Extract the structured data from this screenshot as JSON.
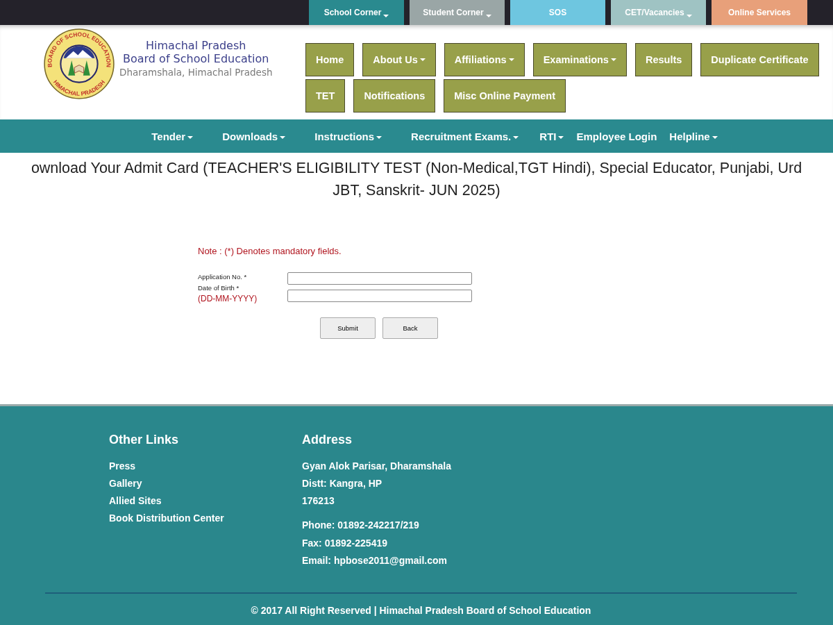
{
  "top_tabs": [
    {
      "label": "School Corner",
      "dropdown": true,
      "color": "#2a8a8f"
    },
    {
      "label": "Student Corner",
      "dropdown": true,
      "color": "#9aa6a6"
    },
    {
      "label": "SOS",
      "dropdown": false,
      "color": "#6ec6e0"
    },
    {
      "label": "CET/Vacancies",
      "dropdown": true,
      "color": "#9fc3c3"
    },
    {
      "label": "Online Services",
      "dropdown": false,
      "color": "#e8a07a"
    }
  ],
  "logo": {
    "ring_top": "BOARD OF SCHOOL EDUCATION",
    "ring_bottom": "HIMACHAL PRADESH"
  },
  "brand": {
    "line_1": "Himachal Pradesh",
    "line_2": "Board of School Education",
    "line_3": "Dharamshala, Himachal Pradesh"
  },
  "main_menu": [
    [
      {
        "label": "Home",
        "dropdown": false
      },
      {
        "label": "About Us",
        "dropdown": true
      },
      {
        "label": "Affiliations",
        "dropdown": true
      },
      {
        "label": "Examinations",
        "dropdown": true
      },
      {
        "label": "Results",
        "dropdown": false
      },
      {
        "label": "Duplicate Certificate",
        "dropdown": false
      }
    ],
    [
      {
        "label": "TET",
        "dropdown": false
      },
      {
        "label": "Notifications",
        "dropdown": false
      },
      {
        "label": "Misc Online Payment",
        "dropdown": false
      }
    ]
  ],
  "sub_menu": [
    {
      "label": "Tender",
      "dropdown": true
    },
    {
      "label": "Downloads",
      "dropdown": true
    },
    {
      "label": "Instructions",
      "dropdown": true
    },
    {
      "label": "Recruitment Exams.",
      "dropdown": true
    },
    {
      "label": "RTI",
      "dropdown": true
    },
    {
      "label": "Employee Login",
      "dropdown": false
    },
    {
      "label": "Helpline",
      "dropdown": true
    }
  ],
  "page_title": {
    "line_1": "ownload Your Admit Card (TEACHER'S ELIGIBILITY TEST (Non-Medical,TGT Hindi), Special Educator, Punjabi, Urd",
    "line_2": "JBT, Sanskrit- JUN 2025)"
  },
  "form": {
    "note": "Note  : (*) Denotes mandatory fields.",
    "fields": [
      {
        "label": "Application No. *"
      },
      {
        "label": "Date of Birth *",
        "hint": "(DD-MM-YYYY)"
      }
    ],
    "buttons": [
      "Submit",
      "Back"
    ]
  },
  "footer": {
    "links_heading": "Other Links",
    "links": [
      "Press",
      "Gallery",
      "Allied Sites",
      "Book Distribution Center"
    ],
    "address_heading": "Address",
    "address_lines": [
      "Gyan Alok Parisar, Dharamshala",
      "Distt: Kangra, HP",
      "176213"
    ],
    "contact_lines": [
      "Phone: 01892-242217/219",
      "Fax: 01892-225419",
      "Email: hpbose2011@gmail.com"
    ],
    "copyright": "© 2017 All Right Reserved | Himachal Pradesh Board of School Education"
  }
}
